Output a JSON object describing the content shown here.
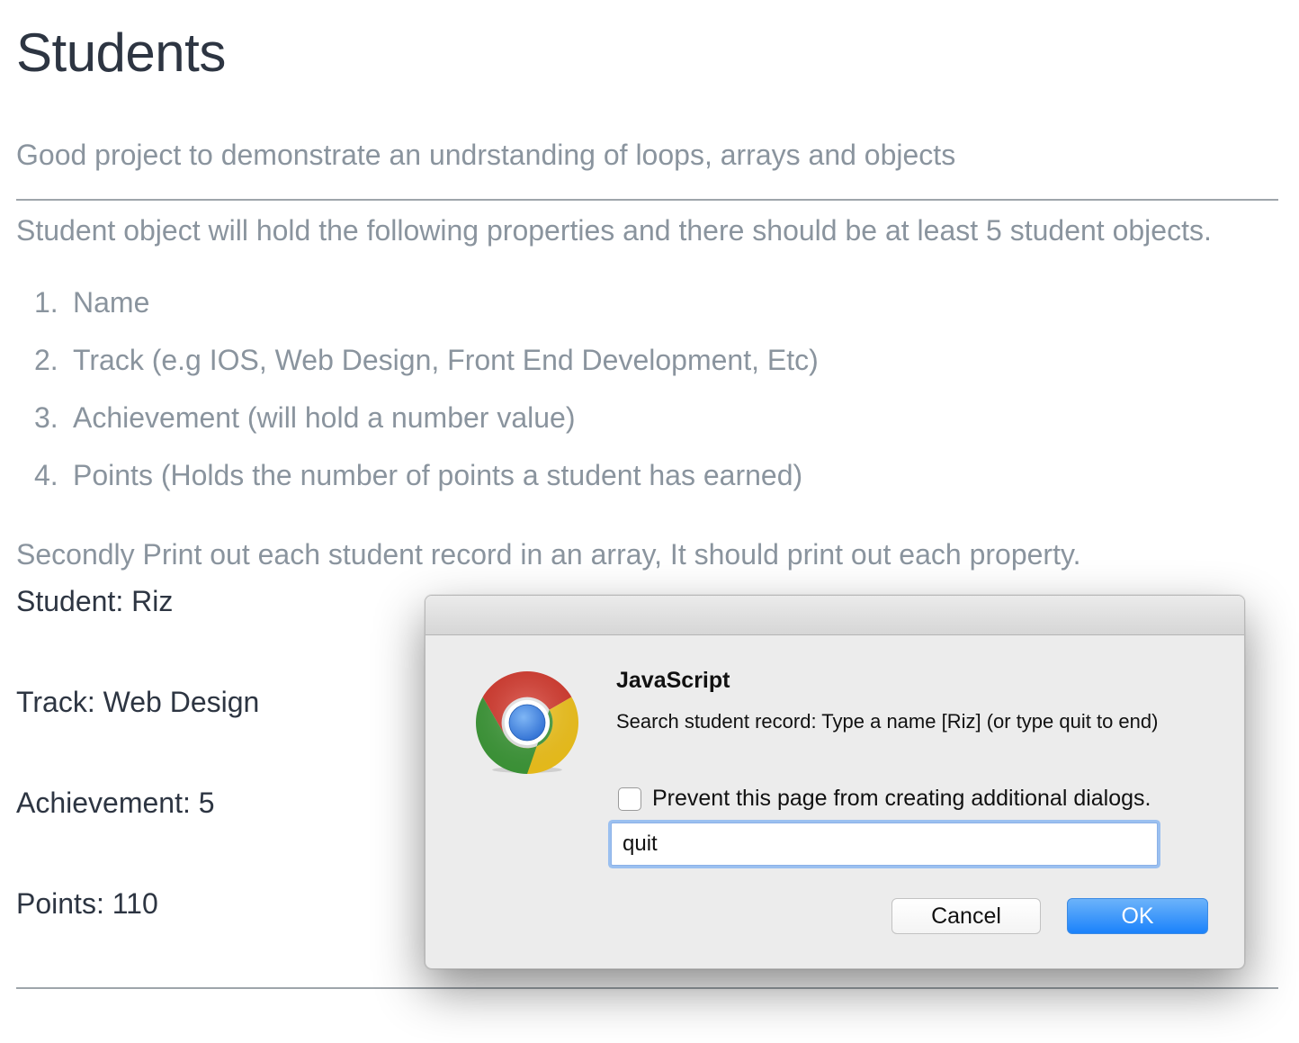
{
  "page": {
    "title": "Students",
    "intro": "Good project to demonstrate an undrstanding of loops, arrays and objects",
    "description": "Student object will hold the following properties and there should be at least 5 student objects.",
    "properties": [
      {
        "num": "1.",
        "text": "Name"
      },
      {
        "num": "2.",
        "text": "Track (e.g IOS, Web Design, Front End Development, Etc)"
      },
      {
        "num": "3.",
        "text": "Achievement (will hold a number value)"
      },
      {
        "num": "4.",
        "text": "Points (Holds the number of points a student has earned)"
      }
    ],
    "secondly": "Secondly Print out each student record in an array, It should print out each property.",
    "record": {
      "student": "Student: Riz",
      "track": "Track: Web Design",
      "achievement": "Achievement: 5",
      "points": "Points: 110"
    }
  },
  "dialog": {
    "icon": "chrome-logo-icon",
    "heading": "JavaScript",
    "message": "Search student record: Type a name [Riz] (or type quit to end)",
    "prevent_label": "Prevent this page from creating additional dialogs.",
    "prevent_checked": false,
    "input_value": "quit",
    "cancel_label": "Cancel",
    "ok_label": "OK",
    "colors": {
      "ok_button": "#1a82fb",
      "focus_ring": "#9bc0f0"
    }
  }
}
